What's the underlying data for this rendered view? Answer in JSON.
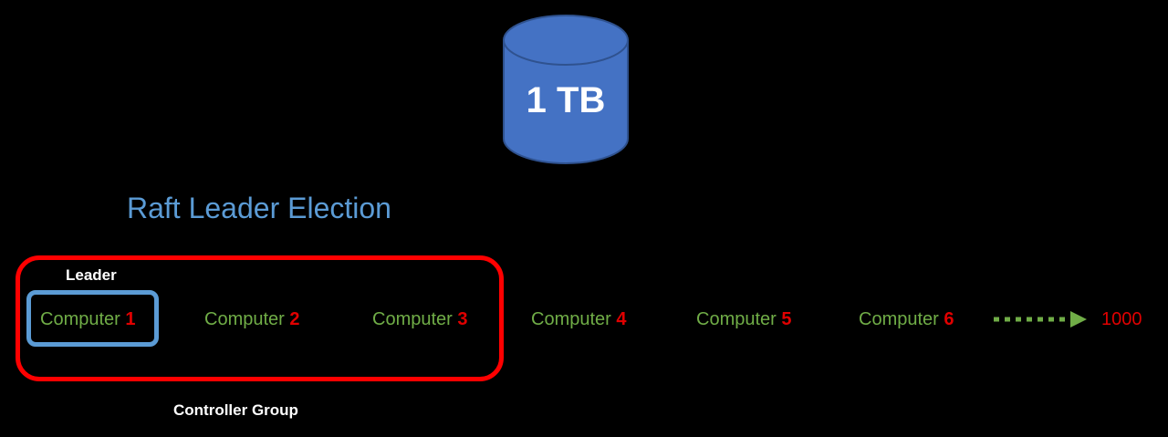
{
  "colors": {
    "background": "#000000",
    "title": "#5b9bd5",
    "database": "#4472c4",
    "computer_text": "#70ad47",
    "number_text": "#e00000",
    "group_border": "#ff0000",
    "leader_border": "#5b9bd5",
    "label_text": "#ffffff"
  },
  "database": {
    "label": "1 TB",
    "icon": "database-cylinder-icon"
  },
  "title": "Raft Leader Election",
  "controller_group": {
    "label": "Controller Group",
    "leader_label": "Leader"
  },
  "computers": [
    {
      "name": "Computer",
      "number": "1"
    },
    {
      "name": "Computer",
      "number": "2"
    },
    {
      "name": "Computer",
      "number": "3"
    },
    {
      "name": "Computer",
      "number": "4"
    },
    {
      "name": "Computer",
      "number": "5"
    },
    {
      "name": "Computer",
      "number": "6"
    }
  ],
  "continuation": {
    "icon": "dotted-arrow-right-icon",
    "end_label": "1000"
  }
}
